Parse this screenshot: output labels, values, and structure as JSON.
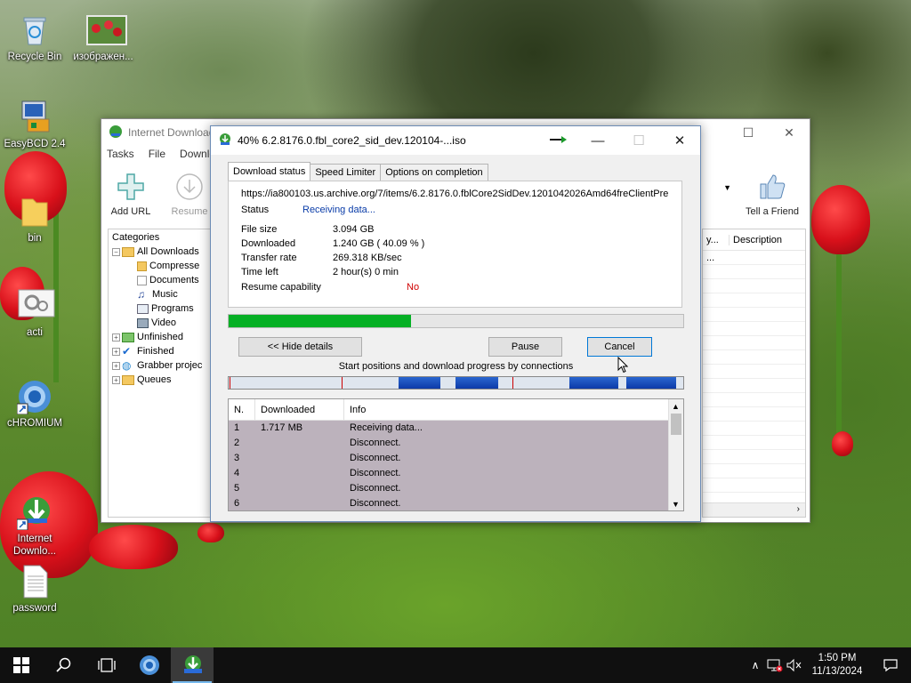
{
  "desktop": {
    "icons": [
      {
        "label": "Recycle Bin",
        "icon": "recycle-bin-icon"
      },
      {
        "label": "изображен...",
        "icon": "image-file-icon"
      },
      {
        "label": "EasyBCD 2.4",
        "icon": "easybcd-icon"
      },
      {
        "label": "bin",
        "icon": "folder-icon"
      },
      {
        "label": "acti",
        "icon": "settings-file-icon"
      },
      {
        "label": "cHROMIUM",
        "icon": "chromium-icon"
      },
      {
        "label": "Internet\nDownlo...",
        "icon": "idm-icon"
      },
      {
        "label": "password",
        "icon": "text-file-icon"
      }
    ]
  },
  "main_window": {
    "title": "Internet Download",
    "menu": [
      "Tasks",
      "File",
      "Downlo"
    ],
    "toolbar": {
      "add_url": "Add URL",
      "resume": "Resume",
      "tell_friend": "Tell a Friend"
    },
    "categories_header": "Categories",
    "categories": {
      "all_downloads": "All Downloads",
      "compressed": "Compresse",
      "documents": "Documents",
      "music": "Music",
      "programs": "Programs",
      "video": "Video",
      "unfinished": "Unfinished",
      "finished": "Finished",
      "grabber": "Grabber projec",
      "queues": "Queues"
    },
    "list_headers": {
      "col1": "y...",
      "description": "Description"
    },
    "list_cell": "..."
  },
  "dialog": {
    "title": "40% 6.2.8176.0.fbl_core2_sid_dev.120104-...iso",
    "tabs": [
      "Download status",
      "Speed Limiter",
      "Options on completion"
    ],
    "url": "https://ia800103.us.archive.org/7/items/6.2.8176.0.fblCore2SidDev.1201042026Amd64freClientPre",
    "status": {
      "label": "Status",
      "value": "Receiving data..."
    },
    "fields": [
      {
        "label": "File size",
        "value": "3.094  GB"
      },
      {
        "label": "Downloaded",
        "value": "1.240  GB  ( 40.09 % )"
      },
      {
        "label": "Transfer rate",
        "value": "269.318  KB/sec"
      },
      {
        "label": "Time left",
        "value": "2 hour(s) 0 min"
      }
    ],
    "resume": {
      "label": "Resume capability",
      "value": "No"
    },
    "progress_fraction": 0.4009,
    "buttons": {
      "hide_details": "<< Hide details",
      "pause": "Pause",
      "cancel": "Cancel"
    },
    "connections_label": "Start positions and download progress by connections",
    "table_headers": {
      "n": "N.",
      "downloaded": "Downloaded",
      "info": "Info"
    },
    "connections": [
      {
        "n": "1",
        "downloaded": "1.717  MB",
        "info": "Receiving data..."
      },
      {
        "n": "2",
        "downloaded": "",
        "info": "Disconnect."
      },
      {
        "n": "3",
        "downloaded": "",
        "info": "Disconnect."
      },
      {
        "n": "4",
        "downloaded": "",
        "info": "Disconnect."
      },
      {
        "n": "5",
        "downloaded": "",
        "info": "Disconnect."
      },
      {
        "n": "6",
        "downloaded": "",
        "info": "Disconnect."
      }
    ]
  },
  "taskbar": {
    "time": "1:50 PM",
    "date": "11/13/2024"
  },
  "colors": {
    "progress_green": "#06b025",
    "status_blue": "#0a3ca8",
    "resume_red": "#d00000",
    "connection_blue": "#0c3aa8"
  }
}
